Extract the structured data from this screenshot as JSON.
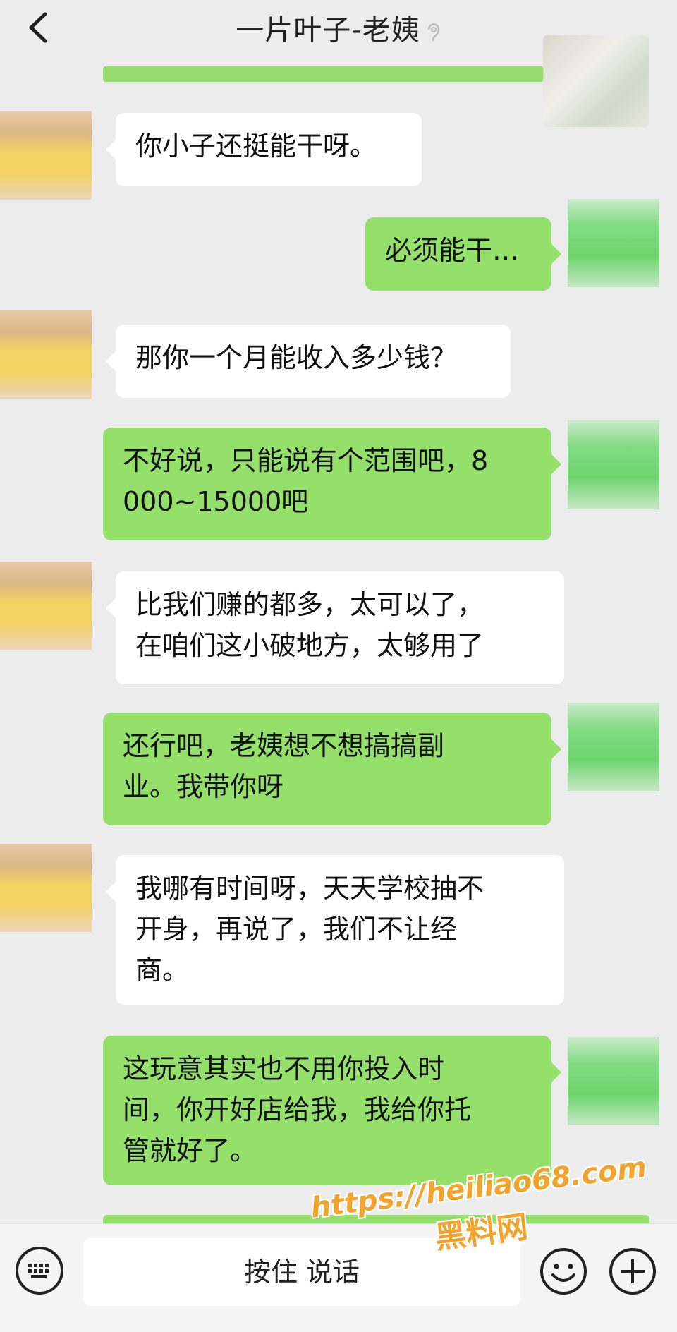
{
  "header": {
    "title": "一片叶子-老姨"
  },
  "messages": [
    {
      "side": "left",
      "text": "你小子还挺能干呀。"
    },
    {
      "side": "right",
      "text": "必须能干…"
    },
    {
      "side": "left",
      "text": "那你一个月能收入多少钱？"
    },
    {
      "side": "right",
      "text": "不好说，只能说有个范围吧，8\n000~15000吧"
    },
    {
      "side": "left",
      "text": "比我们赚的都多，太可以了，\n在咱们这小破地方，太够用了"
    },
    {
      "side": "right",
      "text": "还行吧，老姨想不想搞搞副\n业。我带你呀"
    },
    {
      "side": "left",
      "text": "我哪有时间呀，天天学校抽不\n开身，再说了，我们不让经\n商。"
    },
    {
      "side": "right",
      "text": "这玩意其实也不用你投入时\n间，你开好店给我，我给你托\n管就好了。"
    }
  ],
  "input_bar": {
    "hold_to_talk": "按住 说话"
  },
  "watermark": {
    "url": "https://heiliao68.com",
    "site": "黑料网"
  },
  "colors": {
    "background": "#ececec",
    "green_bubble": "#95e06a",
    "white_bubble": "#ffffff",
    "watermark": "#f2a32b"
  },
  "icons": {
    "back": "chevron-left-icon",
    "mute": "mute-ear-icon",
    "keyboard": "keyboard-icon",
    "emoji": "emoji-icon",
    "plus": "plus-icon"
  }
}
